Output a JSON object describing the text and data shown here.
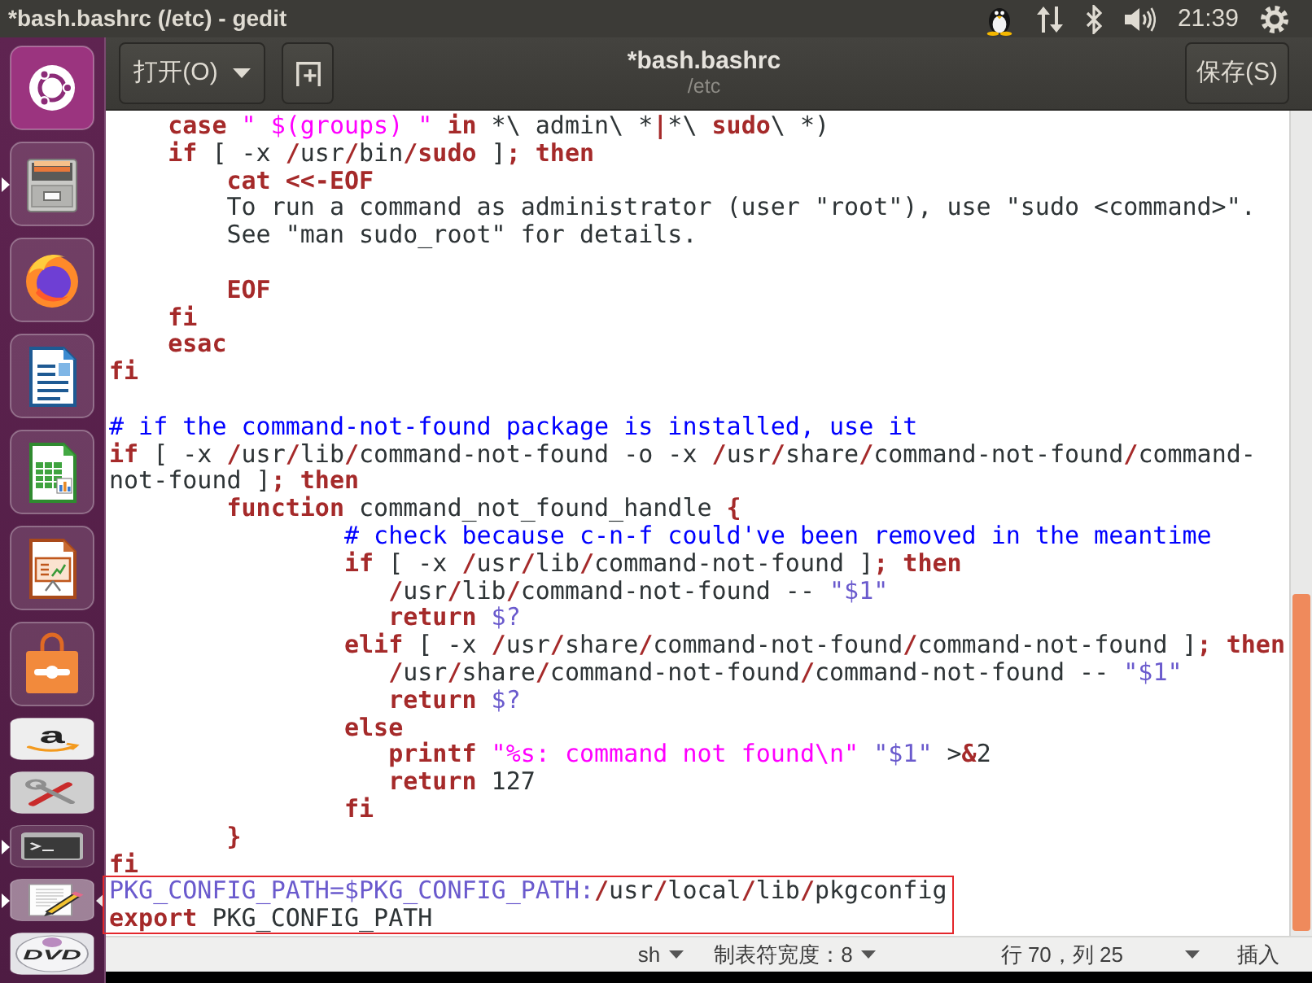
{
  "top_panel": {
    "title": "*bash.bashrc (/etc) - gedit",
    "clock": "21:39"
  },
  "launcher": [
    {
      "kind": "dash",
      "running": false,
      "focused": false,
      "folded": false
    },
    {
      "kind": "files",
      "running": true,
      "focused": false,
      "folded": false
    },
    {
      "kind": "browser",
      "running": false,
      "focused": false,
      "folded": false
    },
    {
      "kind": "document",
      "running": false,
      "focused": false,
      "folded": false
    },
    {
      "kind": "spreadsheet",
      "running": false,
      "focused": false,
      "folded": false
    },
    {
      "kind": "presentation",
      "running": false,
      "focused": false,
      "folded": false
    },
    {
      "kind": "store",
      "running": false,
      "focused": false,
      "folded": false
    },
    {
      "kind": "shop",
      "label": "a",
      "running": false,
      "focused": false,
      "folded": true
    },
    {
      "kind": "settings",
      "running": false,
      "focused": false,
      "folded": true
    },
    {
      "kind": "terminal",
      "running": true,
      "focused": false,
      "folded": true
    },
    {
      "kind": "text_editor",
      "running": true,
      "focused": true,
      "folded": true
    },
    {
      "kind": "disc",
      "label": "DVD",
      "running": false,
      "focused": false,
      "folded": true
    }
  ],
  "headerbar": {
    "open_button": "打开(O)",
    "title": "*bash.bashrc",
    "subtitle": "/etc",
    "save_button": "保存(S)"
  },
  "editor": {
    "lines": [
      {
        "kind": "code",
        "boxed": false,
        "tokens": [
          {
            "kind": "keyword",
            "text": "    case "
          },
          {
            "kind": "string",
            "text": "\" $(groups) \""
          },
          {
            "kind": "keyword",
            "text": " in"
          },
          {
            "kind": "plain",
            "text": " *\\ admin\\ *"
          },
          {
            "kind": "keyword",
            "text": "|"
          },
          {
            "kind": "plain",
            "text": "*\\ "
          },
          {
            "kind": "keyword",
            "text": "sudo"
          },
          {
            "kind": "plain",
            "text": "\\ *)"
          }
        ]
      },
      {
        "kind": "code",
        "boxed": false,
        "tokens": [
          {
            "kind": "keyword",
            "text": "    if"
          },
          {
            "kind": "plain",
            "text": " [ -x "
          },
          {
            "kind": "keyword",
            "text": "/"
          },
          {
            "kind": "plain",
            "text": "usr"
          },
          {
            "kind": "keyword",
            "text": "/"
          },
          {
            "kind": "plain",
            "text": "bin"
          },
          {
            "kind": "keyword",
            "text": "/sudo"
          },
          {
            "kind": "plain",
            "text": " ]"
          },
          {
            "kind": "keyword",
            "text": "; then"
          }
        ]
      },
      {
        "kind": "code",
        "boxed": false,
        "tokens": [
          {
            "kind": "keyword",
            "text": "        cat <<-EOF"
          }
        ]
      },
      {
        "kind": "code",
        "boxed": false,
        "tokens": [
          {
            "kind": "plain",
            "text": "        To run a command as administrator (user \"root\"), use \"sudo <command>\"."
          }
        ]
      },
      {
        "kind": "code",
        "boxed": false,
        "tokens": [
          {
            "kind": "plain",
            "text": "        See \"man sudo_root\" for details."
          }
        ]
      },
      {
        "kind": "blank"
      },
      {
        "kind": "code",
        "boxed": false,
        "tokens": [
          {
            "kind": "keyword",
            "text": "        EOF"
          }
        ]
      },
      {
        "kind": "code",
        "boxed": false,
        "tokens": [
          {
            "kind": "keyword",
            "text": "    fi"
          }
        ]
      },
      {
        "kind": "code",
        "boxed": false,
        "tokens": [
          {
            "kind": "keyword",
            "text": "    esac"
          }
        ]
      },
      {
        "kind": "code",
        "boxed": false,
        "tokens": [
          {
            "kind": "keyword",
            "text": "fi"
          }
        ]
      },
      {
        "kind": "blank"
      },
      {
        "kind": "code",
        "boxed": false,
        "tokens": [
          {
            "kind": "comment",
            "text": "# if the command-not-found package is installed, use it"
          }
        ]
      },
      {
        "kind": "code",
        "boxed": false,
        "tokens": [
          {
            "kind": "keyword",
            "text": "if"
          },
          {
            "kind": "plain",
            "text": " [ -x "
          },
          {
            "kind": "keyword",
            "text": "/"
          },
          {
            "kind": "plain",
            "text": "usr"
          },
          {
            "kind": "keyword",
            "text": "/"
          },
          {
            "kind": "plain",
            "text": "lib"
          },
          {
            "kind": "keyword",
            "text": "/"
          },
          {
            "kind": "plain",
            "text": "command-not-found -o -x "
          },
          {
            "kind": "keyword",
            "text": "/"
          },
          {
            "kind": "plain",
            "text": "usr"
          },
          {
            "kind": "keyword",
            "text": "/"
          },
          {
            "kind": "plain",
            "text": "share"
          },
          {
            "kind": "keyword",
            "text": "/"
          },
          {
            "kind": "plain",
            "text": "command-not-found"
          },
          {
            "kind": "keyword",
            "text": "/"
          },
          {
            "kind": "plain",
            "text": "command-"
          }
        ]
      },
      {
        "kind": "code",
        "boxed": false,
        "tokens": [
          {
            "kind": "plain",
            "text": "not-found ]"
          },
          {
            "kind": "keyword",
            "text": "; then"
          }
        ]
      },
      {
        "kind": "code",
        "boxed": false,
        "tokens": [
          {
            "kind": "keyword",
            "text": "        function"
          },
          {
            "kind": "plain",
            "text": " command_not_found_handle "
          },
          {
            "kind": "keyword",
            "text": "{"
          }
        ]
      },
      {
        "kind": "code",
        "boxed": false,
        "tokens": [
          {
            "kind": "comment",
            "text": "                # check because c-n-f could've been removed in the meantime"
          }
        ]
      },
      {
        "kind": "code",
        "boxed": false,
        "tokens": [
          {
            "kind": "keyword",
            "text": "                if"
          },
          {
            "kind": "plain",
            "text": " [ -x "
          },
          {
            "kind": "keyword",
            "text": "/"
          },
          {
            "kind": "plain",
            "text": "usr"
          },
          {
            "kind": "keyword",
            "text": "/"
          },
          {
            "kind": "plain",
            "text": "lib"
          },
          {
            "kind": "keyword",
            "text": "/"
          },
          {
            "kind": "plain",
            "text": "command-not-found ]"
          },
          {
            "kind": "keyword",
            "text": "; then"
          }
        ]
      },
      {
        "kind": "code",
        "boxed": false,
        "tokens": [
          {
            "kind": "keyword",
            "text": "                   /"
          },
          {
            "kind": "plain",
            "text": "usr"
          },
          {
            "kind": "keyword",
            "text": "/"
          },
          {
            "kind": "plain",
            "text": "lib"
          },
          {
            "kind": "keyword",
            "text": "/"
          },
          {
            "kind": "plain",
            "text": "command-not-found -- "
          },
          {
            "kind": "variable",
            "text": "\"$1\""
          }
        ]
      },
      {
        "kind": "code",
        "boxed": false,
        "tokens": [
          {
            "kind": "keyword",
            "text": "                   return "
          },
          {
            "kind": "variable",
            "text": "$?"
          }
        ]
      },
      {
        "kind": "code",
        "boxed": false,
        "tokens": [
          {
            "kind": "keyword",
            "text": "                elif"
          },
          {
            "kind": "plain",
            "text": " [ -x "
          },
          {
            "kind": "keyword",
            "text": "/"
          },
          {
            "kind": "plain",
            "text": "usr"
          },
          {
            "kind": "keyword",
            "text": "/"
          },
          {
            "kind": "plain",
            "text": "share"
          },
          {
            "kind": "keyword",
            "text": "/"
          },
          {
            "kind": "plain",
            "text": "command-not-found"
          },
          {
            "kind": "keyword",
            "text": "/"
          },
          {
            "kind": "plain",
            "text": "command-not-found ]"
          },
          {
            "kind": "keyword",
            "text": "; then"
          }
        ]
      },
      {
        "kind": "code",
        "boxed": false,
        "tokens": [
          {
            "kind": "keyword",
            "text": "                   /"
          },
          {
            "kind": "plain",
            "text": "usr"
          },
          {
            "kind": "keyword",
            "text": "/"
          },
          {
            "kind": "plain",
            "text": "share"
          },
          {
            "kind": "keyword",
            "text": "/"
          },
          {
            "kind": "plain",
            "text": "command-not-found"
          },
          {
            "kind": "keyword",
            "text": "/"
          },
          {
            "kind": "plain",
            "text": "command-not-found -- "
          },
          {
            "kind": "variable",
            "text": "\"$1\""
          }
        ]
      },
      {
        "kind": "code",
        "boxed": false,
        "tokens": [
          {
            "kind": "keyword",
            "text": "                   return "
          },
          {
            "kind": "variable",
            "text": "$?"
          }
        ]
      },
      {
        "kind": "code",
        "boxed": false,
        "tokens": [
          {
            "kind": "keyword",
            "text": "                else"
          }
        ]
      },
      {
        "kind": "code",
        "boxed": false,
        "tokens": [
          {
            "kind": "keyword",
            "text": "                   printf "
          },
          {
            "kind": "string",
            "text": "\"%s: command not found\\n\" "
          },
          {
            "kind": "variable",
            "text": "\"$1\""
          },
          {
            "kind": "plain",
            "text": " >"
          },
          {
            "kind": "keyword",
            "text": "&"
          },
          {
            "kind": "plain",
            "text": "2"
          }
        ]
      },
      {
        "kind": "code",
        "boxed": false,
        "tokens": [
          {
            "kind": "keyword",
            "text": "                   return"
          },
          {
            "kind": "plain",
            "text": " 127"
          }
        ]
      },
      {
        "kind": "code",
        "boxed": false,
        "tokens": [
          {
            "kind": "keyword",
            "text": "                fi"
          }
        ]
      },
      {
        "kind": "code",
        "boxed": false,
        "tokens": [
          {
            "kind": "keyword",
            "text": "        }"
          }
        ]
      },
      {
        "kind": "code",
        "boxed": false,
        "tokens": [
          {
            "kind": "keyword",
            "text": "fi"
          }
        ]
      },
      {
        "kind": "code",
        "boxed": true,
        "tokens": [
          {
            "kind": "variable",
            "text": "PKG_CONFIG_PATH=$PKG_CONFIG_PATH:"
          },
          {
            "kind": "keyword",
            "text": "/"
          },
          {
            "kind": "plain",
            "text": "usr"
          },
          {
            "kind": "keyword",
            "text": "/"
          },
          {
            "kind": "plain",
            "text": "local"
          },
          {
            "kind": "keyword",
            "text": "/"
          },
          {
            "kind": "plain",
            "text": "lib"
          },
          {
            "kind": "keyword",
            "text": "/"
          },
          {
            "kind": "plain",
            "text": "pkgconfig"
          }
        ]
      },
      {
        "kind": "code",
        "boxed": true,
        "tokens": [
          {
            "kind": "keyword",
            "text": "export"
          },
          {
            "kind": "plain",
            "text": " PKG_CONFIG_PATH"
          }
        ]
      }
    ]
  },
  "status_bar": {
    "language": "sh",
    "tab_width": "制表符宽度：8",
    "cursor_position": "行 70，列 25",
    "insert_mode": "插入"
  }
}
